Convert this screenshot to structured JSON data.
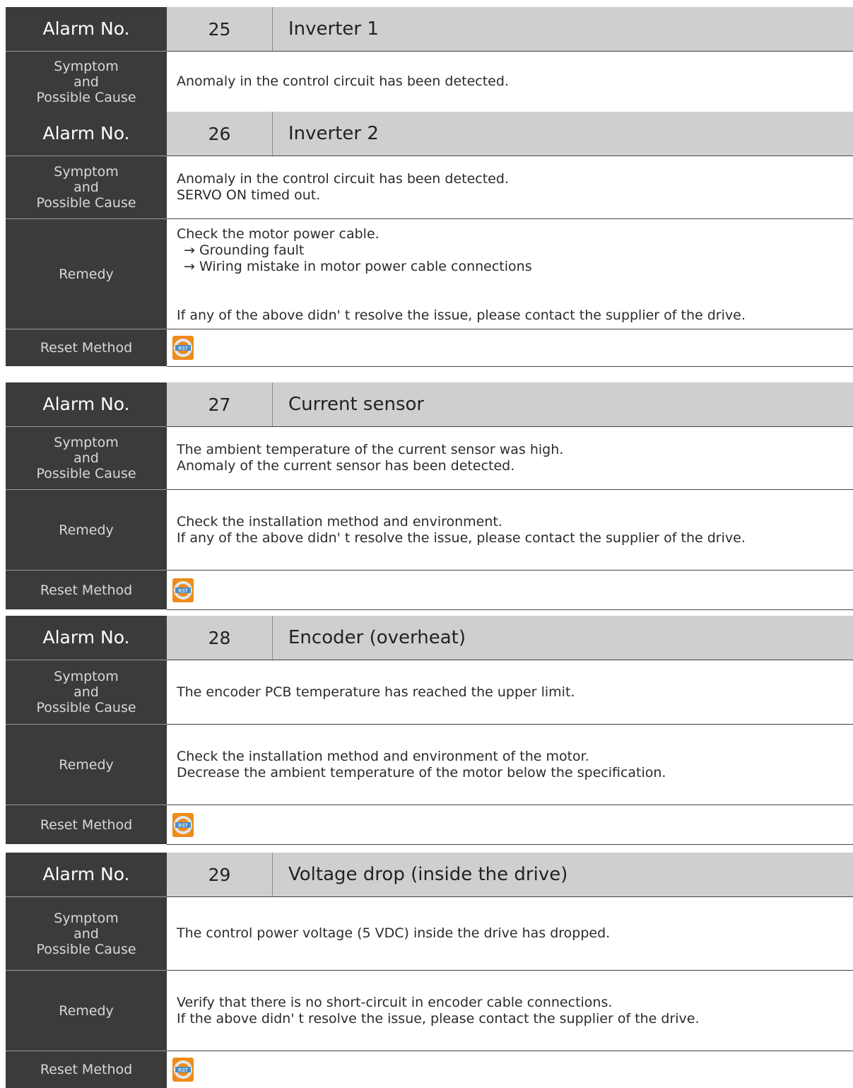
{
  "labels": {
    "alarm_no": "Alarm No.",
    "symptom_1": "Symptom",
    "symptom_2": "and",
    "symptom_3": "Possible Cause",
    "remedy": "Remedy",
    "reset": "Reset Method"
  },
  "reset_icon": {
    "name": "rst-reset-icon",
    "text": "RST",
    "colors": [
      "#f08a18",
      "#4a8fc8"
    ]
  },
  "alarms": [
    {
      "number": "25",
      "title": "Inverter 1",
      "symptom": [
        "Anomaly in the control circuit has been detected."
      ]
    },
    {
      "number": "26",
      "title": "Inverter 2",
      "symptom": [
        "Anomaly in the control circuit has been detected.",
        "SERVO ON timed out."
      ],
      "remedy": [
        "Check the motor power cable.",
        "→ Grounding fault",
        "→ Wiring mistake in motor power cable connections",
        "If any of the above didn' t resolve the issue, please contact the supplier of the drive."
      ]
    },
    {
      "number": "27",
      "title": "Current sensor",
      "symptom": [
        "The ambient temperature of the current sensor was high.",
        "Anomaly of the current sensor has been detected."
      ],
      "remedy": [
        "Check the installation method and environment.",
        "If any of the above didn' t resolve the issue, please contact the supplier of the drive."
      ]
    },
    {
      "number": "28",
      "title": "Encoder (overheat)",
      "symptom": [
        "The encoder PCB temperature has reached the upper limit."
      ],
      "remedy": [
        "Check the installation method and environment of the motor.",
        "Decrease the ambient temperature of the motor below the specification."
      ]
    },
    {
      "number": "29",
      "title": "Voltage drop (inside the drive)",
      "symptom": [
        "The control power voltage (5 VDC) inside the drive has dropped."
      ],
      "remedy": [
        "Verify that there is no short-circuit in encoder cable connections.",
        "If the above didn' t resolve the issue, please contact the supplier of the drive."
      ]
    }
  ]
}
